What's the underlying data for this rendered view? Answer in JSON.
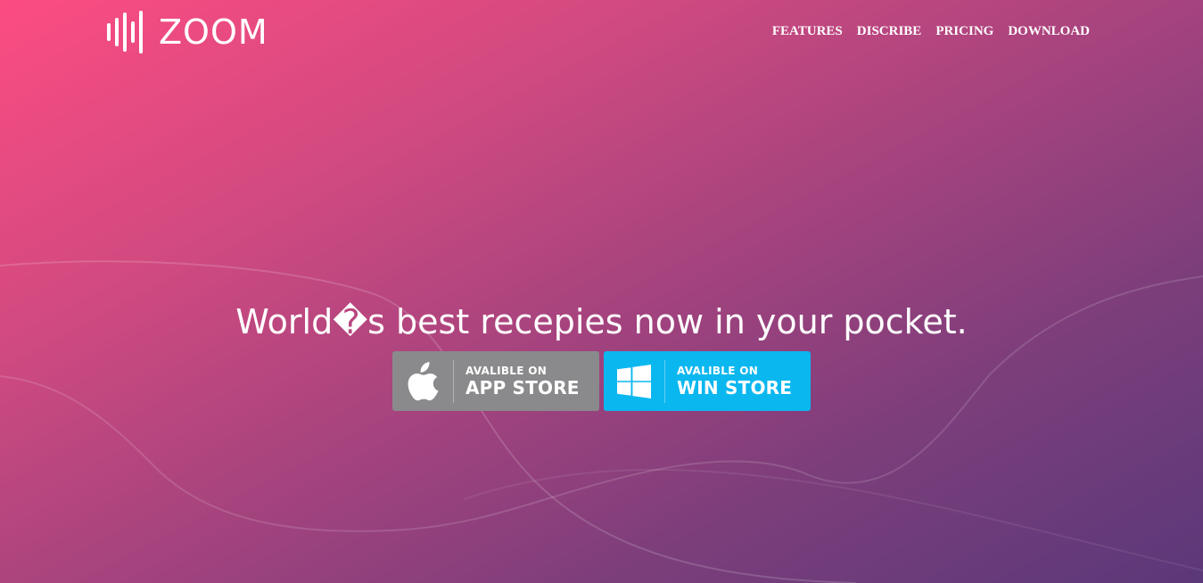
{
  "brand": {
    "name": "ZOOM"
  },
  "nav": {
    "items": [
      "FEATURES",
      "DISCRIBE",
      "PRICING",
      "DOWNLOAD"
    ]
  },
  "hero": {
    "headline": "World�s best recepies now in your pocket.",
    "gradient": [
      "#fc4c82",
      "#5b3879"
    ]
  },
  "stores": {
    "apple": {
      "small": "AVALIBLE ON",
      "big": "APP STORE",
      "icon": "apple-logo-icon",
      "color": "#8a8a8c"
    },
    "windows": {
      "small": "AVALIBLE ON",
      "big": "WIN STORE",
      "icon": "windows-logo-icon",
      "color": "#0bb7ef"
    }
  }
}
